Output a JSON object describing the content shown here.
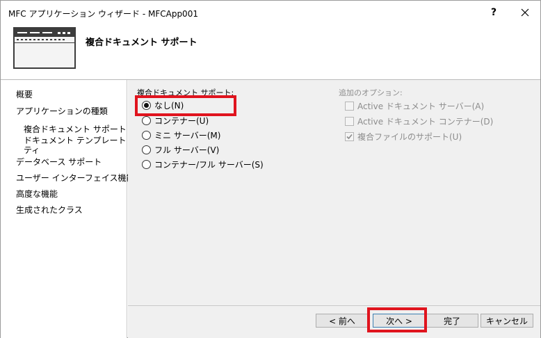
{
  "window": {
    "title": "MFC アプリケーション ウィザード - MFCApp001",
    "help_label": "?"
  },
  "header": {
    "title": "複合ドキュメント サポート"
  },
  "nav": {
    "items": [
      {
        "label": "概要"
      },
      {
        "label": "アプリケーションの種類"
      },
      {
        "label": "複合ドキュメント サポート"
      },
      {
        "label": "ドキュメント テンプレート プロパ"
      },
      {
        "label": "ティ"
      },
      {
        "label": "データベース サポート"
      },
      {
        "label": "ユーザー インターフェイス機能"
      },
      {
        "label": "高度な機能"
      },
      {
        "label": "生成されたクラス"
      }
    ]
  },
  "compound_support": {
    "label": "複合ドキュメント サポート:",
    "options": [
      {
        "label": "なし(N)",
        "checked": true
      },
      {
        "label": "コンテナー(U)",
        "checked": false
      },
      {
        "label": "ミニ サーバー(M)",
        "checked": false
      },
      {
        "label": "フル サーバー(V)",
        "checked": false
      },
      {
        "label": "コンテナー/フル サーバー(S)",
        "checked": false
      }
    ]
  },
  "additional_options": {
    "label": "追加のオプション:",
    "options": [
      {
        "label": "Active ドキュメント サーバー(A)",
        "checked": false
      },
      {
        "label": "Active ドキュメント コンテナー(D)",
        "checked": false
      },
      {
        "label": "複合ファイルのサポート(U)",
        "checked": true
      }
    ]
  },
  "buttons": {
    "back": "< 前へ",
    "next": "次へ >",
    "finish": "完了",
    "cancel": "キャンセル"
  },
  "colors": {
    "highlight": "#e0141e",
    "content_bg": "#f0f0f0",
    "disabled_text": "#8c8c8c"
  }
}
